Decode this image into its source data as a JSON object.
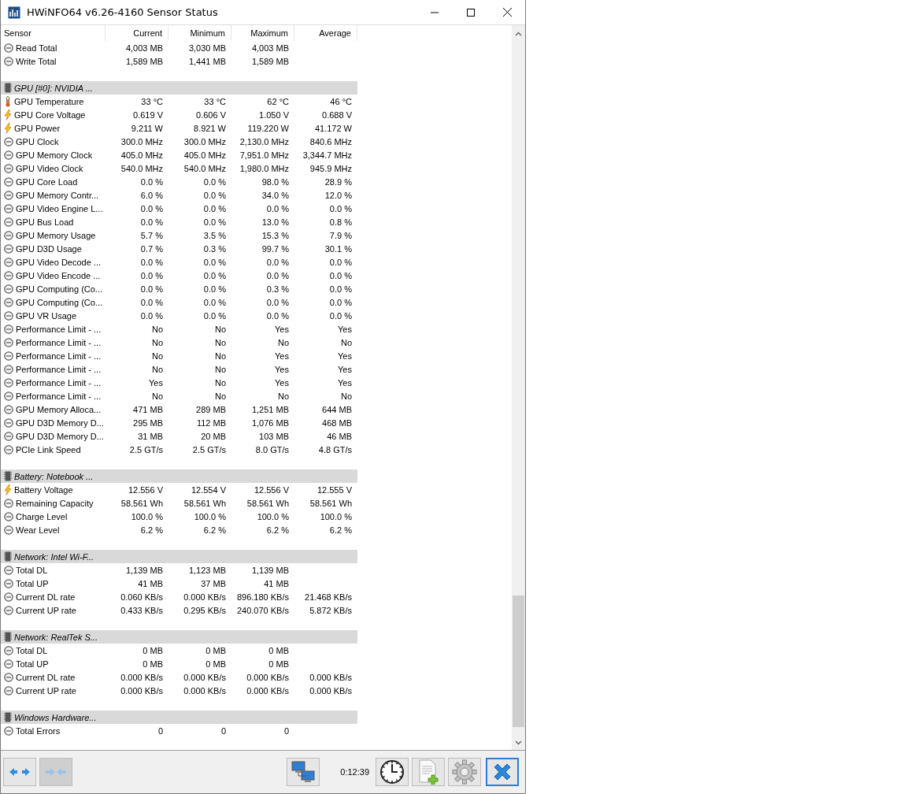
{
  "window": {
    "title": "HWiNFO64 v6.26-4160 Sensor Status"
  },
  "table": {
    "columns": [
      "Sensor",
      "Current",
      "Minimum",
      "Maximum",
      "Average"
    ],
    "rows": [
      {
        "kind": "sensor",
        "name": "Read Total",
        "values": [
          "4,003 MB",
          "3,030 MB",
          "4,003 MB"
        ]
      },
      {
        "kind": "sensor",
        "name": "Write Total",
        "values": [
          "1,589 MB",
          "1,441 MB",
          "1,589 MB"
        ]
      },
      {
        "kind": "blank"
      },
      {
        "kind": "group",
        "name": "GPU [#0]: NVIDIA ..."
      },
      {
        "kind": "temperature",
        "name": "GPU Temperature",
        "values": [
          "33 °C",
          "33 °C",
          "62 °C",
          "46 °C"
        ]
      },
      {
        "kind": "electrical",
        "name": "GPU Core Voltage",
        "values": [
          "0.619 V",
          "0.606 V",
          "1.050 V",
          "0.688 V"
        ]
      },
      {
        "kind": "electrical",
        "name": "GPU Power",
        "values": [
          "9.211 W",
          "8.921 W",
          "119.220 W",
          "41.172 W"
        ]
      },
      {
        "kind": "sensor",
        "name": "GPU Clock",
        "values": [
          "300.0 MHz",
          "300.0 MHz",
          "2,130.0 MHz",
          "840.6 MHz"
        ]
      },
      {
        "kind": "sensor",
        "name": "GPU Memory Clock",
        "values": [
          "405.0 MHz",
          "405.0 MHz",
          "7,951.0 MHz",
          "3,344.7 MHz"
        ]
      },
      {
        "kind": "sensor",
        "name": "GPU Video Clock",
        "values": [
          "540.0 MHz",
          "540.0 MHz",
          "1,980.0 MHz",
          "945.9 MHz"
        ]
      },
      {
        "kind": "sensor",
        "name": "GPU Core Load",
        "values": [
          "0.0 %",
          "0.0 %",
          "98.0 %",
          "28.9 %"
        ]
      },
      {
        "kind": "sensor",
        "name": "GPU Memory Contr...",
        "values": [
          "6.0 %",
          "0.0 %",
          "34.0 %",
          "12.0 %"
        ]
      },
      {
        "kind": "sensor",
        "name": "GPU Video Engine L...",
        "values": [
          "0.0 %",
          "0.0 %",
          "0.0 %",
          "0.0 %"
        ]
      },
      {
        "kind": "sensor",
        "name": "GPU Bus Load",
        "values": [
          "0.0 %",
          "0.0 %",
          "13.0 %",
          "0.8 %"
        ]
      },
      {
        "kind": "sensor",
        "name": "GPU Memory Usage",
        "values": [
          "5.7 %",
          "3.5 %",
          "15.3 %",
          "7.9 %"
        ]
      },
      {
        "kind": "sensor",
        "name": "GPU D3D Usage",
        "values": [
          "0.7 %",
          "0.3 %",
          "99.7 %",
          "30.1 %"
        ]
      },
      {
        "kind": "sensor",
        "name": "GPU Video Decode ...",
        "values": [
          "0.0 %",
          "0.0 %",
          "0.0 %",
          "0.0 %"
        ]
      },
      {
        "kind": "sensor",
        "name": "GPU Video Encode ...",
        "values": [
          "0.0 %",
          "0.0 %",
          "0.0 %",
          "0.0 %"
        ]
      },
      {
        "kind": "sensor",
        "name": "GPU Computing (Co...",
        "values": [
          "0.0 %",
          "0.0 %",
          "0.3 %",
          "0.0 %"
        ]
      },
      {
        "kind": "sensor",
        "name": "GPU Computing (Co...",
        "values": [
          "0.0 %",
          "0.0 %",
          "0.0 %",
          "0.0 %"
        ]
      },
      {
        "kind": "sensor",
        "name": "GPU VR Usage",
        "values": [
          "0.0 %",
          "0.0 %",
          "0.0 %",
          "0.0 %"
        ]
      },
      {
        "kind": "sensor",
        "name": "Performance Limit - ...",
        "values": [
          "No",
          "No",
          "Yes",
          "Yes"
        ]
      },
      {
        "kind": "sensor",
        "name": "Performance Limit - ...",
        "values": [
          "No",
          "No",
          "No",
          "No"
        ]
      },
      {
        "kind": "sensor",
        "name": "Performance Limit - ...",
        "values": [
          "No",
          "No",
          "Yes",
          "Yes"
        ]
      },
      {
        "kind": "sensor",
        "name": "Performance Limit - ...",
        "values": [
          "No",
          "No",
          "Yes",
          "Yes"
        ]
      },
      {
        "kind": "sensor",
        "name": "Performance Limit - ...",
        "values": [
          "Yes",
          "No",
          "Yes",
          "Yes"
        ]
      },
      {
        "kind": "sensor",
        "name": "Performance Limit - ...",
        "values": [
          "No",
          "No",
          "No",
          "No"
        ]
      },
      {
        "kind": "sensor",
        "name": "GPU Memory Alloca...",
        "values": [
          "471 MB",
          "289 MB",
          "1,251 MB",
          "644 MB"
        ]
      },
      {
        "kind": "sensor",
        "name": "GPU D3D Memory D...",
        "values": [
          "295 MB",
          "112 MB",
          "1,076 MB",
          "468 MB"
        ]
      },
      {
        "kind": "sensor",
        "name": "GPU D3D Memory D...",
        "values": [
          "31 MB",
          "20 MB",
          "103 MB",
          "46 MB"
        ]
      },
      {
        "kind": "sensor",
        "name": "PCIe Link Speed",
        "values": [
          "2.5 GT/s",
          "2.5 GT/s",
          "8.0 GT/s",
          "4.8 GT/s"
        ]
      },
      {
        "kind": "blank"
      },
      {
        "kind": "group",
        "name": "Battery: Notebook ..."
      },
      {
        "kind": "electrical",
        "name": "Battery Voltage",
        "values": [
          "12.556 V",
          "12.554 V",
          "12.556 V",
          "12.555 V"
        ]
      },
      {
        "kind": "sensor",
        "name": "Remaining Capacity",
        "values": [
          "58.561 Wh",
          "58.561 Wh",
          "58.561 Wh",
          "58.561 Wh"
        ]
      },
      {
        "kind": "sensor",
        "name": "Charge Level",
        "values": [
          "100.0 %",
          "100.0 %",
          "100.0 %",
          "100.0 %"
        ]
      },
      {
        "kind": "sensor",
        "name": "Wear Level",
        "values": [
          "6.2 %",
          "6.2 %",
          "6.2 %",
          "6.2 %"
        ]
      },
      {
        "kind": "blank"
      },
      {
        "kind": "group",
        "name": "Network: Intel Wi-F..."
      },
      {
        "kind": "sensor",
        "name": "Total DL",
        "values": [
          "1,139 MB",
          "1,123 MB",
          "1,139 MB"
        ]
      },
      {
        "kind": "sensor",
        "name": "Total UP",
        "values": [
          "41 MB",
          "37 MB",
          "41 MB"
        ]
      },
      {
        "kind": "sensor",
        "name": "Current DL rate",
        "values": [
          "0.060 KB/s",
          "0.000 KB/s",
          "896.180 KB/s",
          "21.468 KB/s"
        ]
      },
      {
        "kind": "sensor",
        "name": "Current UP rate",
        "values": [
          "0.433 KB/s",
          "0.295 KB/s",
          "240.070 KB/s",
          "5.872 KB/s"
        ]
      },
      {
        "kind": "blank"
      },
      {
        "kind": "group",
        "name": "Network: RealTek S..."
      },
      {
        "kind": "sensor",
        "name": "Total DL",
        "values": [
          "0 MB",
          "0 MB",
          "0 MB"
        ]
      },
      {
        "kind": "sensor",
        "name": "Total UP",
        "values": [
          "0 MB",
          "0 MB",
          "0 MB"
        ]
      },
      {
        "kind": "sensor",
        "name": "Current DL rate",
        "values": [
          "0.000 KB/s",
          "0.000 KB/s",
          "0.000 KB/s",
          "0.000 KB/s"
        ]
      },
      {
        "kind": "sensor",
        "name": "Current UP rate",
        "values": [
          "0.000 KB/s",
          "0.000 KB/s",
          "0.000 KB/s",
          "0.000 KB/s"
        ]
      },
      {
        "kind": "blank"
      },
      {
        "kind": "group",
        "name": "Windows Hardware..."
      },
      {
        "kind": "sensor",
        "name": "Total Errors",
        "values": [
          "0",
          "0",
          "0"
        ]
      },
      {
        "kind": "blank"
      }
    ]
  },
  "toolbar": {
    "left": [
      {
        "kind": "expand",
        "disabled": false
      },
      {
        "kind": "collapse",
        "disabled": true
      }
    ],
    "elapsed": "0:12:39",
    "right": [
      {
        "kind": "clock"
      },
      {
        "kind": "report"
      },
      {
        "kind": "settings"
      },
      {
        "kind": "close"
      }
    ]
  }
}
